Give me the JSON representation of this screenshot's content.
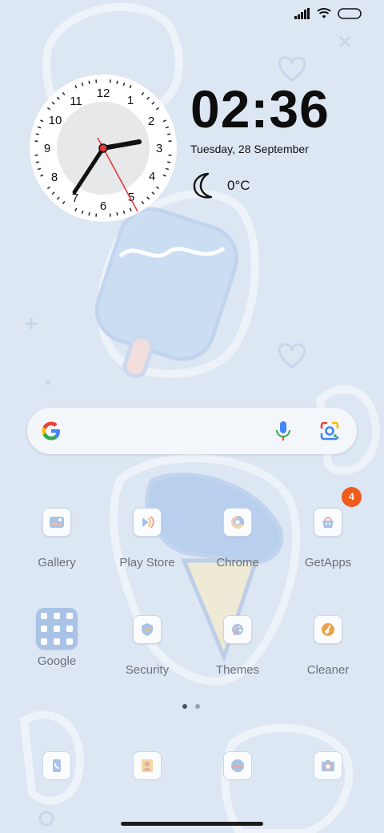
{
  "status_bar": {
    "icons": [
      "signal-icon",
      "wifi-icon",
      "battery-icon"
    ]
  },
  "clock_widget": {
    "numbers": [
      "12",
      "1",
      "2",
      "3",
      "4",
      "5",
      "6",
      "7",
      "8",
      "9",
      "10",
      "11"
    ],
    "time_shown": "02:36"
  },
  "digital_clock": {
    "time": "02:36",
    "date": "Tuesday, 28 September"
  },
  "weather": {
    "icon": "moon-icon",
    "temperature": "0°C"
  },
  "search_bar": {
    "icons": [
      "google-logo-icon",
      "microphone-icon",
      "google-lens-icon"
    ]
  },
  "apps": [
    {
      "label": "Gallery",
      "icon": "gallery-icon"
    },
    {
      "label": "Play Store",
      "icon": "play-store-icon"
    },
    {
      "label": "Chrome",
      "icon": "chrome-icon"
    },
    {
      "label": "GetApps",
      "icon": "getapps-icon",
      "badge": "4"
    },
    {
      "label": "Google",
      "icon": "google-folder-icon"
    },
    {
      "label": "Security",
      "icon": "security-icon"
    },
    {
      "label": "Themes",
      "icon": "themes-icon"
    },
    {
      "label": "Cleaner",
      "icon": "cleaner-icon"
    }
  ],
  "page_indicator": {
    "pages": 2,
    "current": 1
  },
  "dock": [
    {
      "icon": "phone-icon"
    },
    {
      "icon": "contacts-icon"
    },
    {
      "icon": "browser-icon"
    },
    {
      "icon": "camera-icon"
    }
  ],
  "colors": {
    "wallpaper": "#dde6f3",
    "badge": "#ef5a1f",
    "accent_blue": "#a9c3e6"
  }
}
